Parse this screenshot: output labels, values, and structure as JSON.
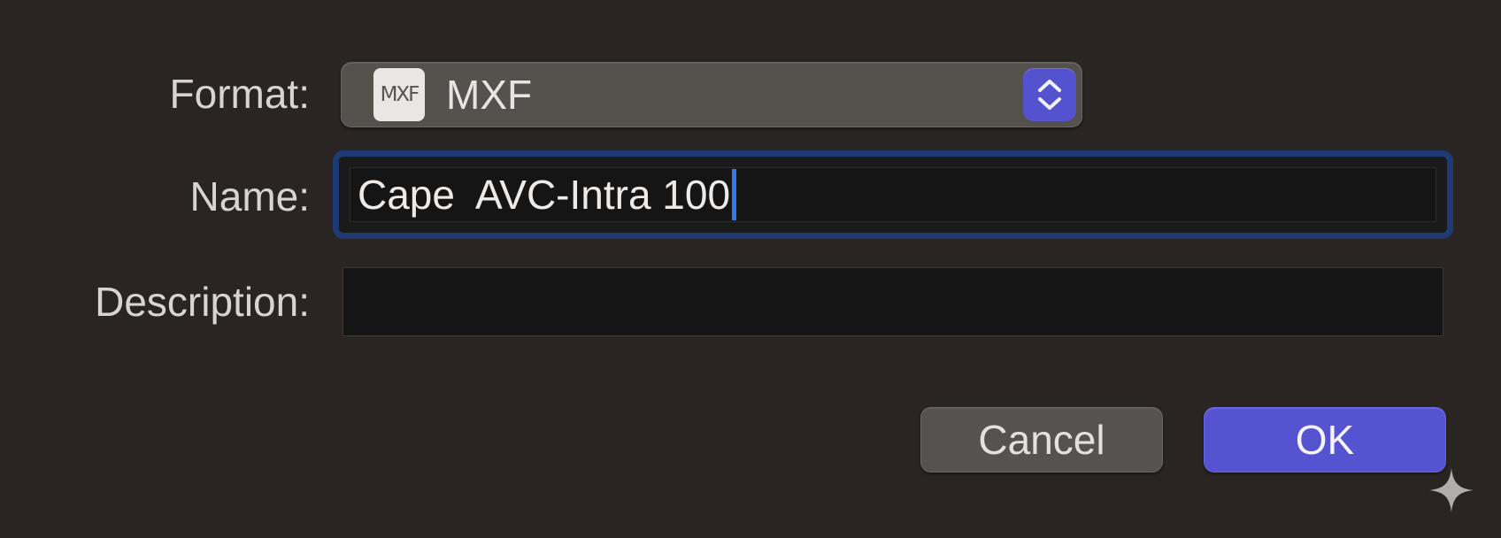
{
  "format": {
    "label": "Format:",
    "icon_text": "MXF",
    "value": "MXF",
    "icon": "mxf-file-icon",
    "stepper_icon": "up-down-chevron-icon"
  },
  "name": {
    "label": "Name:",
    "value": "Cape  AVC-Intra 100"
  },
  "description": {
    "label": "Description:",
    "value": ""
  },
  "buttons": {
    "cancel": "Cancel",
    "ok": "OK"
  },
  "colors": {
    "accent": "#5553cf",
    "focus_ring": "#1d3a73",
    "caret": "#2f79f6",
    "background": "#2a2523"
  },
  "corner_icon": "sparkle-icon"
}
